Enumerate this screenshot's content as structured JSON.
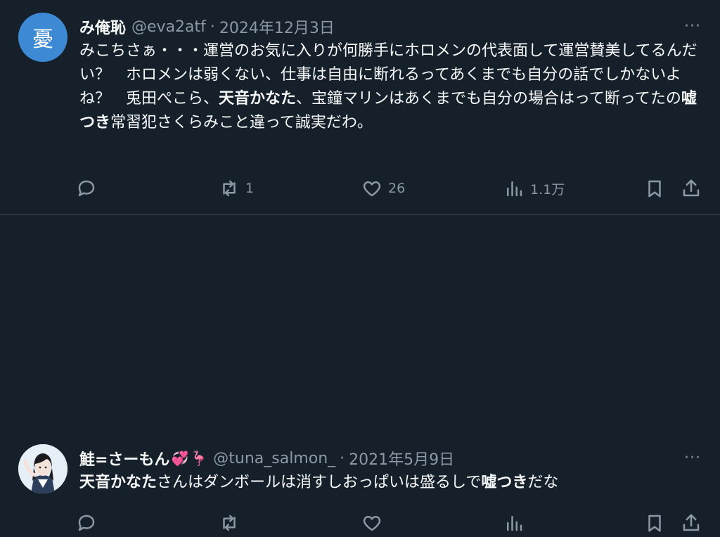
{
  "tweets": [
    {
      "avatar_glyph": "憂",
      "avatar_color": "#3d89d4",
      "name": "み俺恥",
      "handle": "@eva2atf",
      "sep": "·",
      "date": "2024年12月3日",
      "body_parts": [
        "みこちさぁ・・・運営のお気に入りが何勝手にホロメンの代表面して運営賛美してるんだい？　ホロメンは弱くない、仕事は自由に断れるってあくまでも自分の話でしかないよね？　兎田ぺこら、",
        "天音かなた",
        "、宝鐘マリンはあくまでも自分の場合はって断ってたの",
        "嘘つき",
        "常習犯さくらみこと違って誠実だわ。"
      ],
      "stats": {
        "retweets": "1",
        "likes": "26",
        "views": "1.1万"
      }
    },
    {
      "avatar_icon": "anime-avatar",
      "name": "鮭=さーもん",
      "name_emoji_1": "💞",
      "name_emoji_2": "🦩",
      "handle": "@tuna_salmon_",
      "sep": "·",
      "date": "2021年5月9日",
      "body_parts": [
        "天音かなた",
        "さんはダンボールは消すしおっぱいは盛るしで",
        "嘘つき",
        "だな"
      ],
      "stats": {
        "retweets": "",
        "likes": "",
        "views": ""
      }
    }
  ],
  "more_glyph": "···",
  "colors": {
    "background": "#15202b",
    "text": "#f7f9f9",
    "muted": "#8b98a5",
    "divider": "#38444d"
  }
}
